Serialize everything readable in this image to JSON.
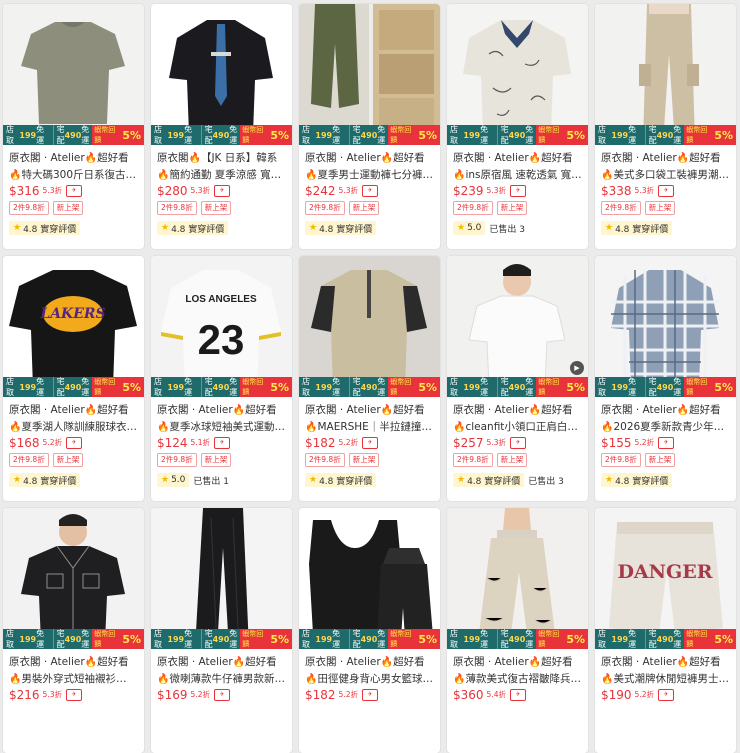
{
  "banner": {
    "shop_label": "店取",
    "shop_threshold": "199",
    "shop_free": "免運",
    "home_label": "宅配",
    "home_threshold": "490",
    "home_free": "免運",
    "promo_small": "蝦幣回饋",
    "promo_big": "5%"
  },
  "products": [
    {
      "line1": "原衣閣 · Atelier",
      "hot": "超好看",
      "line2": "特大碼300斤日系復古…",
      "price": "$316",
      "disc": "5.3折",
      "tags": [
        "2件9.8折",
        "新上架"
      ],
      "rating": "4.8 實穿評價",
      "sold": ""
    },
    {
      "line1": "原衣閣",
      "hot": "【JK 日系】韓系",
      "line2": "簡約通勤 夏季涼感 寬鬆…",
      "price": "$280",
      "disc": "5.3折",
      "tags": [
        "2件9.8折",
        "新上架"
      ],
      "rating": "4.8 實穿評價",
      "sold": ""
    },
    {
      "line1": "原衣閣 · Atelier",
      "hot": "超好看",
      "line2": "夏季男士運動褲七分褲…",
      "price": "$242",
      "disc": "5.3折",
      "tags": [
        "2件9.8折",
        "新上架"
      ],
      "rating": "4.8 實穿評價",
      "sold": ""
    },
    {
      "line1": "原衣閣 · Atelier",
      "hot": "超好看",
      "line2": "ins原宿風 速乾透氣 寬…",
      "price": "$239",
      "disc": "5.3折",
      "tags": [
        "2件9.8折",
        "新上架"
      ],
      "rating": "5.0",
      "sold": "已售出 3"
    },
    {
      "line1": "原衣閣 · Atelier",
      "hot": "超好看",
      "line2": "美式多口袋工裝褲男潮…",
      "price": "$338",
      "disc": "5.3折",
      "tags": [
        "2件9.8折",
        "新上架"
      ],
      "rating": "4.8 實穿評價",
      "sold": ""
    },
    {
      "line1": "原衣閣 · Atelier",
      "hot": "超好看",
      "line2": "夏季湖人隊訓練服球衣…",
      "price": "$168",
      "disc": "5.2折",
      "tags": [
        "2件9.8折",
        "新上架"
      ],
      "rating": "4.8 實穿評價",
      "sold": ""
    },
    {
      "line1": "原衣閣 · Atelier",
      "hot": "超好看",
      "line2": "夏季冰球短袖美式運動…",
      "price": "$124",
      "disc": "5.1折",
      "tags": [
        "2件9.8折",
        "新上架"
      ],
      "rating": "5.0",
      "sold": "已售出 1"
    },
    {
      "line1": "原衣閣 · Atelier",
      "hot": "超好看",
      "line2": "MAERSHE｜半拉鏈撞…",
      "price": "$182",
      "disc": "5.2折",
      "tags": [
        "2件9.8折",
        "新上架"
      ],
      "rating": "4.8 實穿評價",
      "sold": ""
    },
    {
      "line1": "原衣閣 · Atelier",
      "hot": "超好看",
      "line2": "cleanfit小領口正肩白…",
      "price": "$257",
      "disc": "5.3折",
      "tags": [
        "2件9.8折",
        "新上架"
      ],
      "rating": "4.8 實穿評價",
      "sold": "已售出 3"
    },
    {
      "line1": "原衣閣 · Atelier",
      "hot": "超好看",
      "line2": "2026夏季新款青少年…",
      "price": "$155",
      "disc": "5.2折",
      "tags": [
        "2件9.8折",
        "新上架"
      ],
      "rating": "4.8 實穿評價",
      "sold": ""
    },
    {
      "line1": "原衣閣 · Atelier",
      "hot": "超好看",
      "line2": "男裝外穿式短袖襯衫…",
      "price": "$216",
      "disc": "5.3折",
      "tags": [],
      "rating": "",
      "sold": ""
    },
    {
      "line1": "原衣閣 · Atelier",
      "hot": "超好看",
      "line2": "微喇薄款牛仔褲男款新…",
      "price": "$169",
      "disc": "5.2折",
      "tags": [],
      "rating": "",
      "sold": ""
    },
    {
      "line1": "原衣閣 · Atelier",
      "hot": "超好看",
      "line2": "田徑健身背心男女籃球…",
      "price": "$182",
      "disc": "5.2折",
      "tags": [],
      "rating": "",
      "sold": ""
    },
    {
      "line1": "原衣閣 · Atelier",
      "hot": "超好看",
      "line2": "薄款美式復古褶皺降兵…",
      "price": "$360",
      "disc": "5.4折",
      "tags": [],
      "rating": "",
      "sold": ""
    },
    {
      "line1": "原衣閣 · Atelier",
      "hot": "超好看",
      "line2": "美式潮牌休閒短褲男士…",
      "price": "$190",
      "disc": "5.2折",
      "tags": [],
      "rating": "",
      "sold": ""
    }
  ],
  "image_text": {
    "p6": "LAKERS",
    "p7_top": "LOS ANGELES",
    "p7_num": "23",
    "p15": "DANGER"
  },
  "colors": {
    "accent": "#e8333a",
    "banner": "#1f6b6b",
    "star": "#f5b800"
  }
}
